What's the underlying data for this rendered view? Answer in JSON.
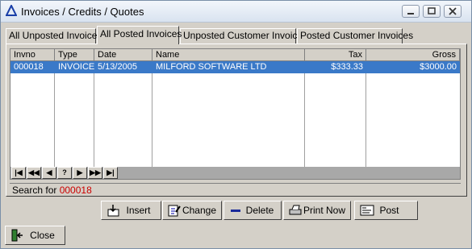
{
  "window": {
    "title": "Invoices / Credits / Quotes"
  },
  "tabs": [
    {
      "label": "All Unposted Invoices"
    },
    {
      "label": "All Posted Invoices"
    },
    {
      "label": "Unposted Customer Invoices"
    },
    {
      "label": "Posted Customer Invoices"
    }
  ],
  "grid": {
    "columns": [
      "Invno",
      "Type",
      "Date",
      "Name",
      "Tax",
      "Gross"
    ],
    "rows": [
      {
        "invno": "000018",
        "type": "INVOICE",
        "date": "5/13/2005",
        "name": "MILFORD SOFTWARE LTD",
        "tax": "$333.33",
        "gross": "$3000.00"
      }
    ]
  },
  "navigator": {
    "first": "|◀",
    "prev_page": "◀◀",
    "prev": "◀",
    "help": "?",
    "next": "▶",
    "next_page": "▶▶",
    "last": "▶|"
  },
  "search": {
    "label": "Search for",
    "value": "000018"
  },
  "actions": {
    "insert": "Insert",
    "change": "Change",
    "delete": "Delete",
    "print_now": "Print Now",
    "post": "Post",
    "close": "Close"
  }
}
